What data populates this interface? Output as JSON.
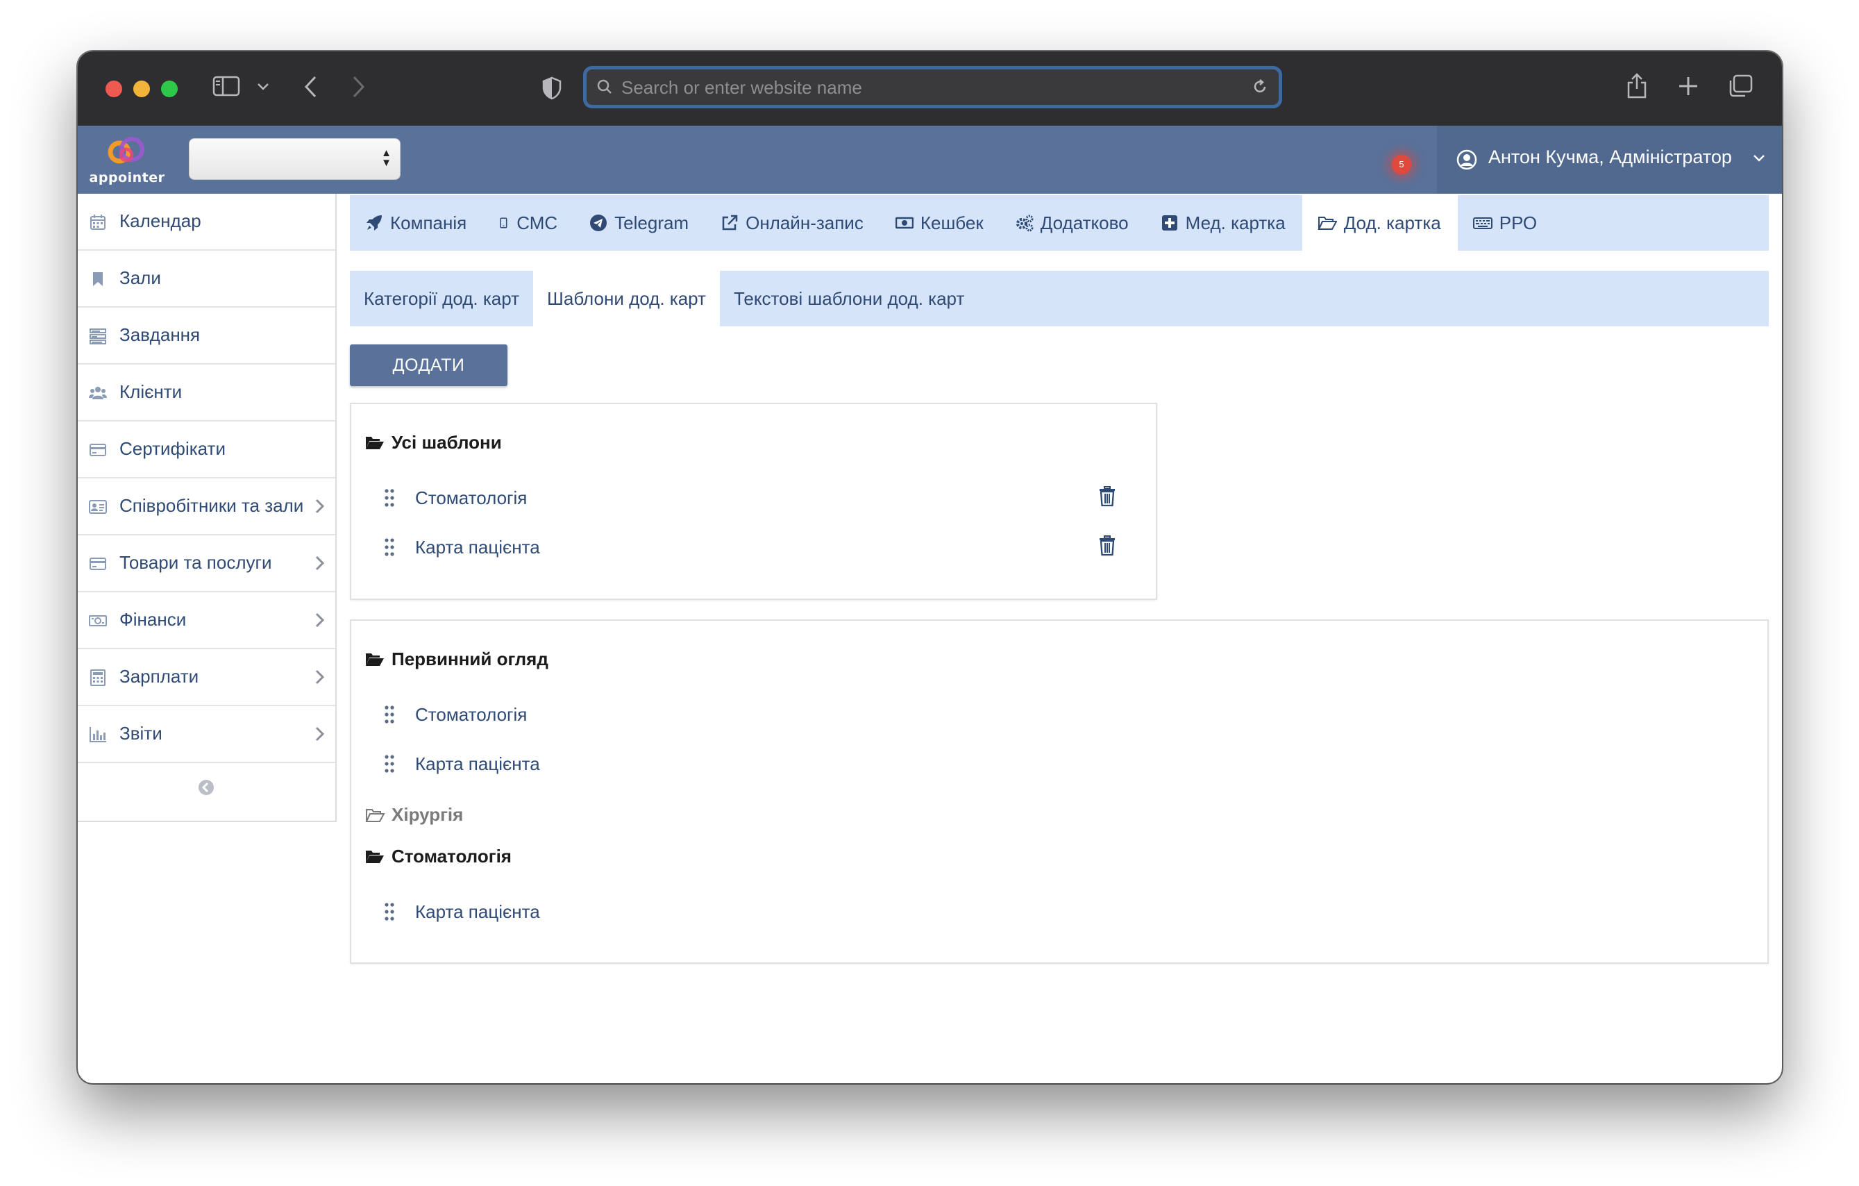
{
  "browser": {
    "address_placeholder": "Search or enter website name"
  },
  "app": {
    "logo_text": "appointer",
    "notification_count": "5",
    "user_name": "Антон Кучма, Адміністратор"
  },
  "sidebar": {
    "items": [
      {
        "label": "Календар",
        "icon": "calendar-icon",
        "has_children": false
      },
      {
        "label": "Зали",
        "icon": "bookmark-icon",
        "has_children": false
      },
      {
        "label": "Завдання",
        "icon": "tasks-icon",
        "has_children": false
      },
      {
        "label": "Клієнти",
        "icon": "users-icon",
        "has_children": false
      },
      {
        "label": "Сертифікати",
        "icon": "credit-card-icon",
        "has_children": false
      },
      {
        "label": "Співробітники та зали",
        "icon": "id-card-icon",
        "has_children": true
      },
      {
        "label": "Товари та послуги",
        "icon": "credit-card-icon",
        "has_children": true
      },
      {
        "label": "Фінанси",
        "icon": "money-icon",
        "has_children": true
      },
      {
        "label": "Зарплати",
        "icon": "calculator-icon",
        "has_children": true
      },
      {
        "label": "Звіти",
        "icon": "bar-chart-icon",
        "has_children": true
      }
    ]
  },
  "tabs": [
    {
      "label": "Компанія",
      "icon": "rocket-icon",
      "active": false
    },
    {
      "label": "СМС",
      "icon": "mobile-icon",
      "active": false
    },
    {
      "label": "Telegram",
      "icon": "telegram-icon",
      "active": false
    },
    {
      "label": "Онлайн-запис",
      "icon": "external-link-icon",
      "active": false
    },
    {
      "label": "Кешбек",
      "icon": "money-icon",
      "active": false
    },
    {
      "label": "Додатково",
      "icon": "gears-icon",
      "active": false
    },
    {
      "label": "Мед. картка",
      "icon": "plus-square-icon",
      "active": false
    },
    {
      "label": "Дод. картка",
      "icon": "folder-open-icon",
      "active": true
    },
    {
      "label": "РРО",
      "icon": "keyboard-icon",
      "active": false
    }
  ],
  "subtabs": [
    {
      "label": "Категорії дод. карт",
      "active": false
    },
    {
      "label": "Шаблони дод. карт",
      "active": true
    },
    {
      "label": "Текстові шаблони дод. карт",
      "active": false
    }
  ],
  "add_button_label": "ДОДАТИ",
  "panel_all": {
    "title": "Усі шаблони",
    "items": [
      "Стоматологія",
      "Карта пацієнта"
    ]
  },
  "panel_categories": {
    "groups": [
      {
        "title": "Первинний огляд",
        "expanded": true,
        "items": [
          "Стоматологія",
          "Карта пацієнта"
        ]
      },
      {
        "title": "Хірургія",
        "expanded": false,
        "items": []
      },
      {
        "title": "Стоматологія",
        "expanded": true,
        "items": [
          "Карта пацієнта"
        ]
      }
    ]
  },
  "colors": {
    "header_bg": "#5a7199",
    "tab_bg": "#d5e4f9",
    "link_text": "#2f4a74",
    "notification": "#e04a3c"
  }
}
